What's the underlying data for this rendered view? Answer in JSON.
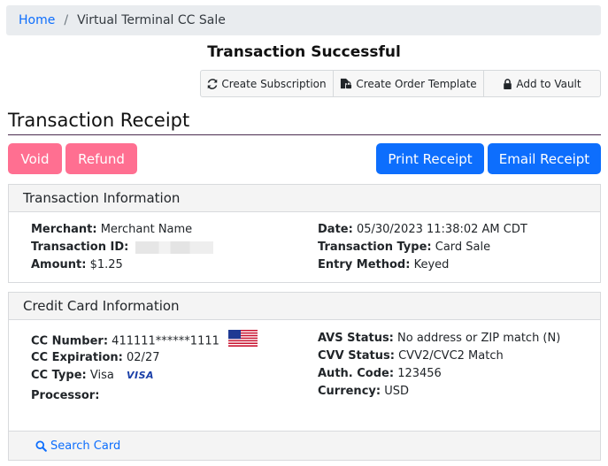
{
  "breadcrumb": {
    "home": "Home",
    "separator": "/",
    "current": "Virtual Terminal CC Sale"
  },
  "status_title": "Transaction Successful",
  "actions": {
    "create_subscription": "Create Subscription",
    "create_order_template": "Create Order Template",
    "add_to_vault": "Add to Vault"
  },
  "receipt_title": "Transaction Receipt",
  "buttons": {
    "void": "Void",
    "refund": "Refund",
    "print_receipt": "Print Receipt",
    "email_receipt": "Email Receipt"
  },
  "colors": {
    "pink": "#ff6f91",
    "blue": "#0d6efd"
  },
  "transaction": {
    "header": "Transaction Information",
    "merchant_label": "Merchant:",
    "merchant": "Merchant Name",
    "txn_id_label": "Transaction ID:",
    "amount_label": "Amount:",
    "amount": "$1.25",
    "date_label": "Date:",
    "date": "05/30/2023 11:38:02 AM CDT",
    "type_label": "Transaction Type:",
    "type": "Card Sale",
    "entry_label": "Entry Method:",
    "entry": "Keyed"
  },
  "card_info": {
    "header": "Credit Card Information",
    "number_label": "CC Number:",
    "number": "411111******1111",
    "exp_label": "CC Expiration:",
    "exp": "02/27",
    "type_label": "CC Type:",
    "type": "Visa",
    "brand_logo": "VISA",
    "processor_label": "Processor:",
    "avs_label": "AVS Status:",
    "avs": "No address or ZIP match (N)",
    "cvv_label": "CVV Status:",
    "cvv": "CVV2/CVC2 Match",
    "auth_label": "Auth. Code:",
    "auth": "123456",
    "currency_label": "Currency:",
    "currency": "USD",
    "search_card": "Search Card"
  }
}
